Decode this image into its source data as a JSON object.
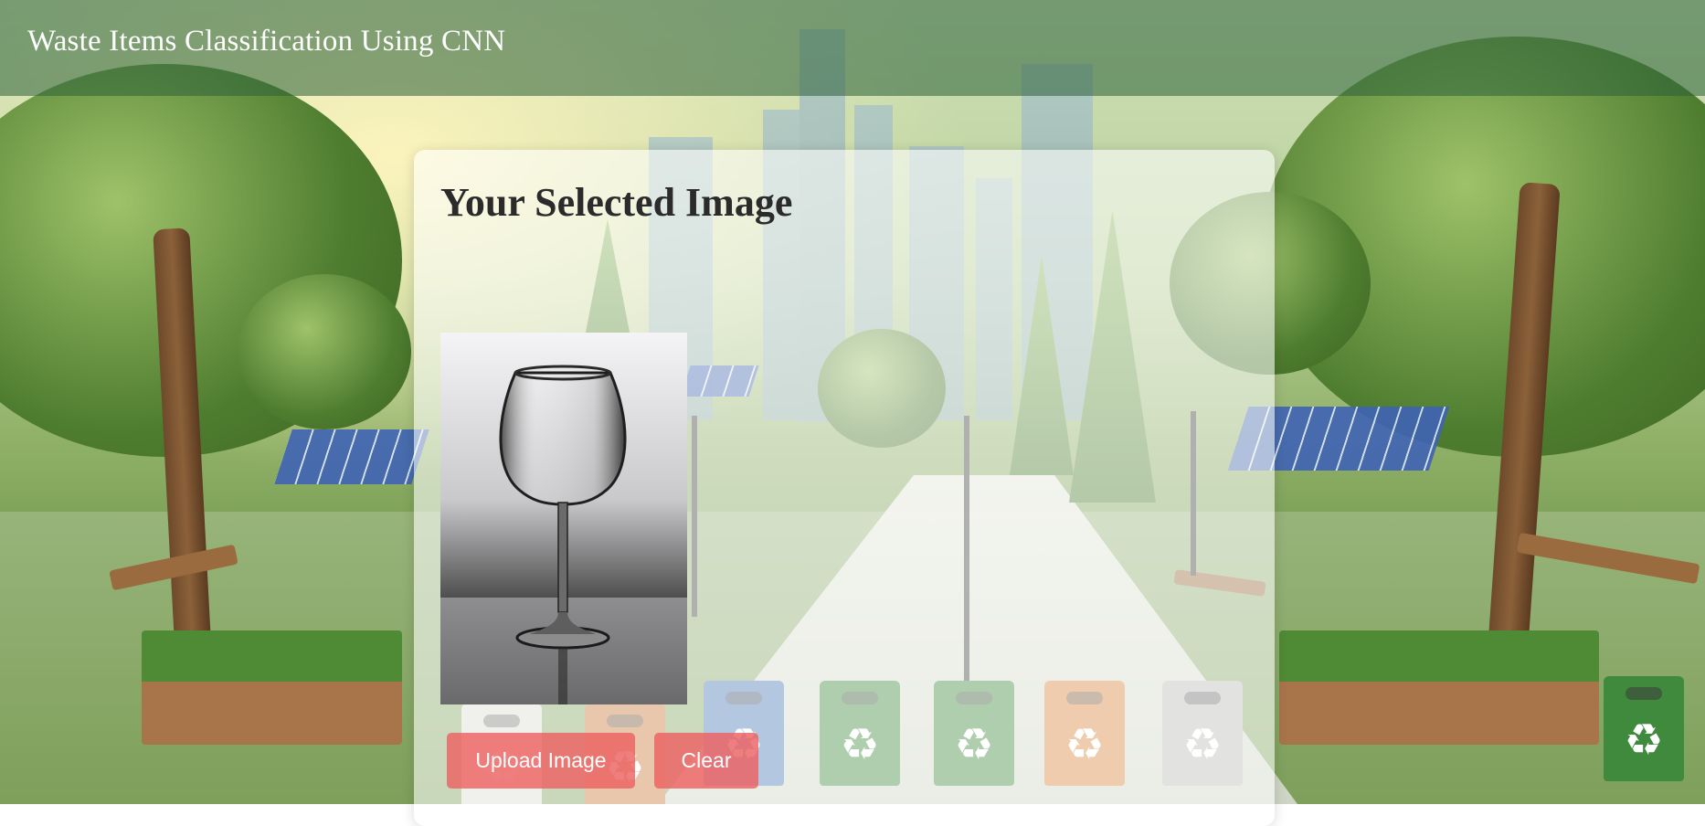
{
  "header": {
    "title": "Waste Items Classification Using CNN"
  },
  "card": {
    "heading": "Your Selected Image",
    "image_subject": "wine-glass-photo",
    "upload_label": "Upload Image",
    "clear_label": "Clear"
  },
  "colors": {
    "header_bg": "#2c6038",
    "button_bg": "#ec6262",
    "heading_text": "#2b2b2b"
  }
}
